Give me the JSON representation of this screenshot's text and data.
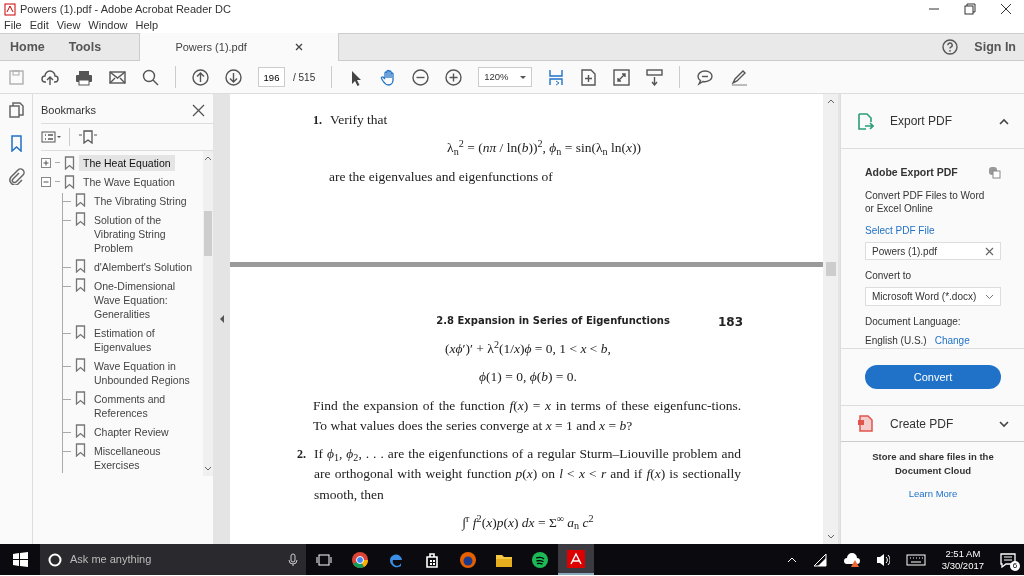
{
  "window": {
    "title": "Powers (1).pdf - Adobe Acrobat Reader DC"
  },
  "menu": [
    "File",
    "Edit",
    "View",
    "Window",
    "Help"
  ],
  "nav": [
    "Home",
    "Tools"
  ],
  "document_tab": {
    "label": "Powers (1).pdf",
    "selected": true
  },
  "sign_in": "Sign In",
  "toolbar": {
    "page_number": "196",
    "page_count": "/ 515",
    "zoom": "120%"
  },
  "rail": [
    {
      "kind": "pages",
      "selected": false
    },
    {
      "kind": "bookmarks",
      "selected": true
    },
    {
      "kind": "attachments",
      "selected": false
    }
  ],
  "bookmarks": {
    "title": "Bookmarks",
    "items": [
      {
        "label": "The Heat Equation",
        "selected": true,
        "expanded": false
      },
      {
        "label": "The Wave Equation",
        "selected": false,
        "expanded": true,
        "children": [
          {
            "label": "The Vibrating String",
            "selected": false
          },
          {
            "label": "Solution of the Vibrating String Problem",
            "selected": false
          },
          {
            "label": "d'Alembert's Solution",
            "selected": false
          },
          {
            "label": "One-Dimensional Wave Equation: Generalities",
            "selected": false
          },
          {
            "label": "Estimation of Eigenvalues",
            "selected": false
          },
          {
            "label": "Wave Equation in Unbounded Regions",
            "selected": false
          },
          {
            "label": "Comments and References",
            "selected": false
          },
          {
            "label": "Chapter Review",
            "selected": false
          },
          {
            "label": "Miscellaneous Exercises",
            "selected": false
          }
        ]
      }
    ]
  },
  "document": {
    "pages": [
      {
        "blocks": [
          {
            "kind": "item",
            "number": "1.",
            "text": "Verify that"
          },
          {
            "kind": "equation",
            "text": "λ$_{n}$$^{2}$ = (*nπ* / ln(*b*))$^{2}$,     *ϕ*$_{n}$ = sin(λ$_{n}$ ln(*x*))"
          },
          {
            "kind": "para",
            "text": "are the eigenvalues and eigenfunctions of"
          }
        ]
      },
      {
        "blocks": [
          {
            "kind": "header",
            "section": "2.8  Expansion in Series of Eigenfunctions",
            "page": "183"
          },
          {
            "kind": "equation",
            "text": "(*xϕ*′)′ + λ$^{2}$(1/*x*)*ϕ* = 0,     1 < *x* < *b*,"
          },
          {
            "kind": "equation",
            "text": "*ϕ*(1) = 0,     *ϕ*(*b*) = 0."
          },
          {
            "kind": "para",
            "text": "Find the expansion of the function *f*(*x*) = *x* in terms of these eigenfunc-tions. To what values does the series converge at *x* = 1 and *x* = *b*?"
          },
          {
            "kind": "item",
            "number": "2.",
            "text": "If *ϕ*$_{1}$, *ϕ*$_{2}$, . . . are the eigenfunctions of a regular Sturm–Liouville problem and are orthogonal with weight function *p*(*x*) on *l* < *x* < *r* and if *f*(*x*) is sectionally smooth, then"
          },
          {
            "kind": "equation",
            "text": "∫$^{r}$ *f*$^{2}$(*x*)*p*(*x*) *dx* = Σ$^{∞}$ *a*$_{n}$ *c*$^{2}$"
          }
        ]
      }
    ]
  },
  "export_pdf": {
    "title": "Export PDF",
    "expanded": true,
    "heading": "Adobe Export PDF",
    "description": "Convert PDF Files to Word or Excel Online",
    "select_label": "Select PDF File",
    "file": "Powers (1).pdf",
    "convert_label": "Convert to",
    "format": "Microsoft Word (*.docx)",
    "language_label": "Document Language:",
    "language": "English (U.S.)",
    "change_link": "Change",
    "button": "Convert"
  },
  "create_pdf": {
    "title": "Create PDF",
    "expanded": false
  },
  "cloud": {
    "text": "Store and share files in the Document Cloud",
    "link": "Learn More"
  },
  "taskbar": {
    "search_placeholder": "Ask me anything",
    "apps": [
      {
        "kind": "chrome",
        "active": false
      },
      {
        "kind": "edge",
        "active": false
      },
      {
        "kind": "store",
        "active": false
      },
      {
        "kind": "firefox",
        "active": false
      },
      {
        "kind": "folder",
        "active": false
      },
      {
        "kind": "spotify",
        "active": false
      },
      {
        "kind": "acrobat",
        "active": true
      }
    ],
    "time": "2:51 AM",
    "date": "3/30/2017",
    "notifications": "6"
  }
}
